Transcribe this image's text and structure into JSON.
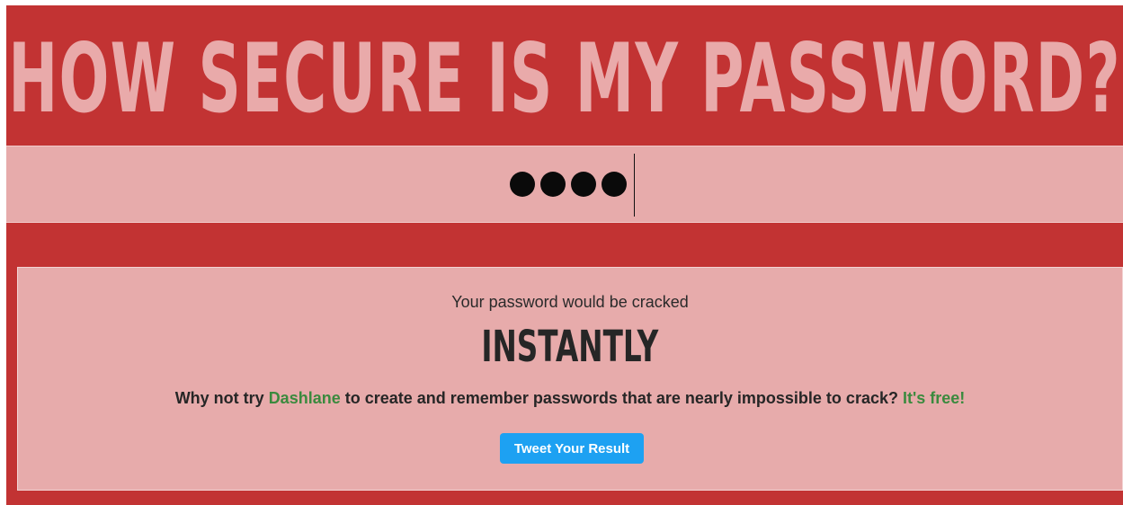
{
  "header": {
    "title": "HOW SECURE IS MY PASSWORD?"
  },
  "password_input": {
    "masked_value": "••••",
    "length": 4
  },
  "result": {
    "intro": "Your password would be cracked",
    "time": "INSTANTLY",
    "promo_prefix": "Why not try ",
    "promo_link": "Dashlane",
    "promo_middle": " to create and remember passwords that are nearly impossible to crack? ",
    "promo_free": "It's free!",
    "tweet_button": "Tweet Your Result"
  },
  "colors": {
    "frame": "#c23333",
    "band": "#e7abab",
    "title_text": "#e9aaaa",
    "link_green": "#3b8a3e",
    "tweet_blue": "#1da1f2"
  }
}
